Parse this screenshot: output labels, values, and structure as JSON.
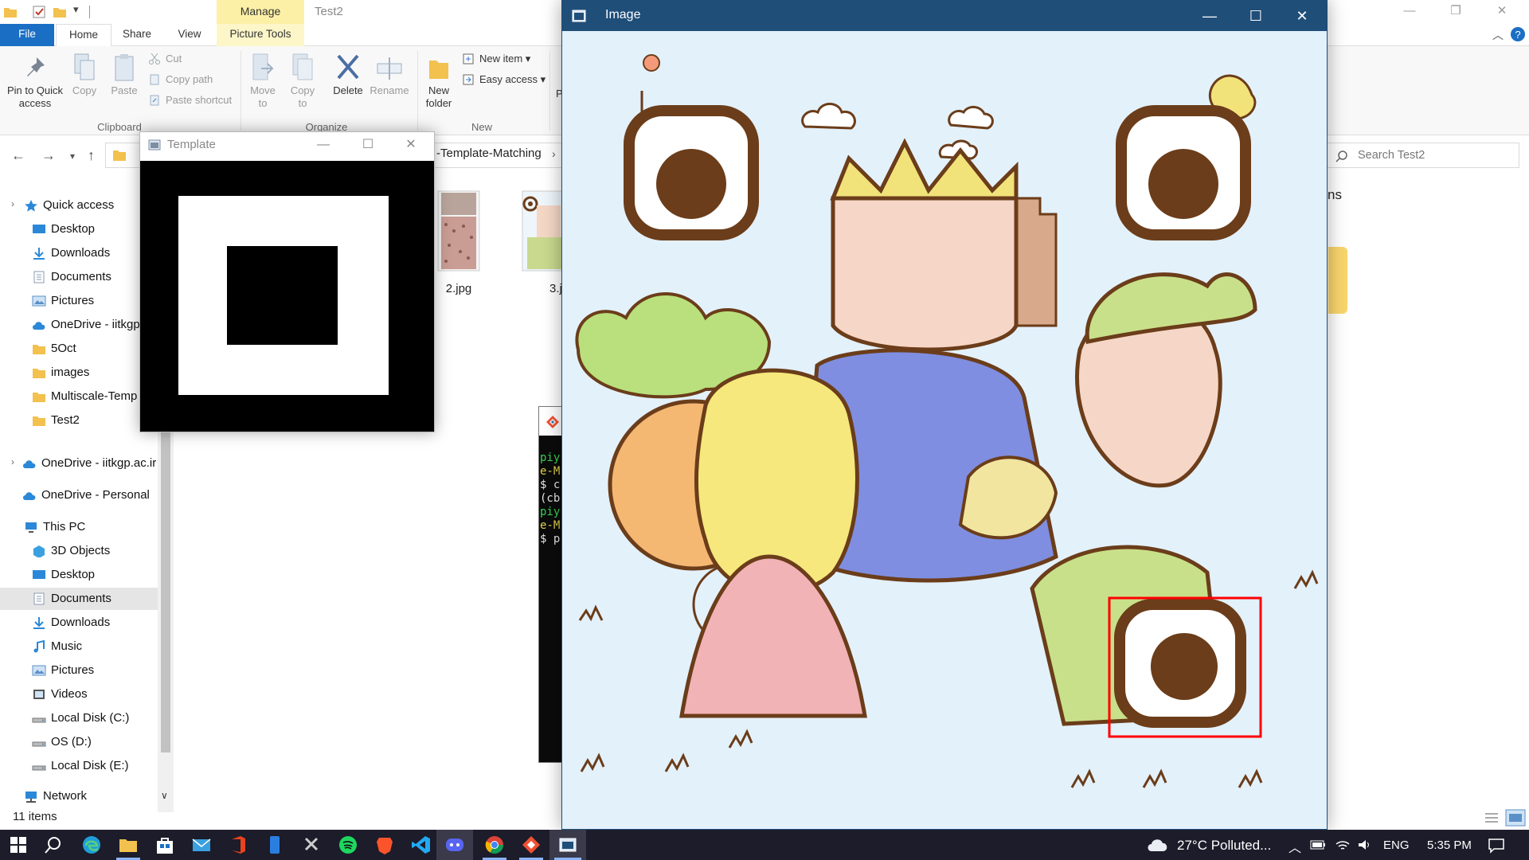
{
  "explorer": {
    "title": "Test2",
    "context_tab": "Manage",
    "tabs": [
      "File",
      "Home",
      "Share",
      "View",
      "Picture Tools"
    ],
    "ribbon": {
      "pin_label": "Pin to Quick access",
      "copy_label": "Copy",
      "paste_label": "Paste",
      "cut_label": "Cut",
      "copy_path_label": "Copy path",
      "paste_shortcut_label": "Paste shortcut",
      "move_to_label": "Move to",
      "copy_to_label": "Copy to",
      "delete_label": "Delete",
      "rename_label": "Rename",
      "new_folder_label": "New folder",
      "new_item_label": "New item",
      "easy_access_label": "Easy access",
      "group_clipboard": "Clipboard",
      "group_organize": "Organize",
      "group_new": "New",
      "partial_label": "P"
    },
    "address_path": "-Template-Matching",
    "search_placeholder": "Search Test2",
    "partial_column_text": "ns",
    "nav": {
      "items": [
        {
          "label": "Quick access",
          "icon": "star-icon"
        },
        {
          "label": "Desktop",
          "icon": "desktop-icon"
        },
        {
          "label": "Downloads",
          "icon": "download-icon"
        },
        {
          "label": "Documents",
          "icon": "documents-icon"
        },
        {
          "label": "Pictures",
          "icon": "pictures-icon"
        },
        {
          "label": "OneDrive - iitkgp",
          "icon": "cloud-icon"
        },
        {
          "label": "5Oct",
          "icon": "folder-icon"
        },
        {
          "label": "images",
          "icon": "folder-icon"
        },
        {
          "label": "Multiscale-Temp",
          "icon": "folder-icon"
        },
        {
          "label": "Test2",
          "icon": "folder-icon"
        },
        {
          "label": "OneDrive - iitkgp.ac.ir",
          "icon": "cloud-icon"
        },
        {
          "label": "OneDrive - Personal",
          "icon": "cloud-icon"
        },
        {
          "label": "This PC",
          "icon": "pc-icon"
        },
        {
          "label": "3D Objects",
          "icon": "3d-objects-icon"
        },
        {
          "label": "Desktop",
          "icon": "desktop-icon"
        },
        {
          "label": "Documents",
          "icon": "documents-icon"
        },
        {
          "label": "Downloads",
          "icon": "download-icon"
        },
        {
          "label": "Music",
          "icon": "music-icon"
        },
        {
          "label": "Pictures",
          "icon": "pictures-icon"
        },
        {
          "label": "Videos",
          "icon": "videos-icon"
        },
        {
          "label": "Local Disk (C:)",
          "icon": "drive-icon"
        },
        {
          "label": "OS (D:)",
          "icon": "drive-icon"
        },
        {
          "label": "Local Disk (E:)",
          "icon": "drive-icon"
        },
        {
          "label": "Network",
          "icon": "network-icon"
        }
      ]
    },
    "files": [
      {
        "name": "2.jpg"
      },
      {
        "name": "3.j"
      }
    ],
    "status": "11 items"
  },
  "template_window": {
    "title": "Template"
  },
  "terminal": {
    "lines": [
      {
        "text": "piy",
        "color": "#39d353"
      },
      {
        "text": "e-M",
        "color": "#e3d34a"
      },
      {
        "text": "$ c",
        "color": "#e8e8e8"
      },
      {
        "text": "(cb",
        "color": "#e8e8e8"
      },
      {
        "text": "piy",
        "color": "#39d353"
      },
      {
        "text": "e-M",
        "color": "#e3d34a"
      },
      {
        "text": "$ p",
        "color": "#e8e8e8"
      }
    ]
  },
  "image_window": {
    "title": "Image"
  },
  "colors": {
    "explorer_file_tab": "#1a6fc4",
    "manage_highlight": "#fbf0a6",
    "image_titlebar": "#1f4e79",
    "detection_box": "#ff0000",
    "marker_brown": "#6b3d1a",
    "taskbar": "#1c1c2a"
  },
  "taskbar": {
    "weather": "27°C Polluted...",
    "language": "ENG",
    "time": "5:35 PM"
  }
}
